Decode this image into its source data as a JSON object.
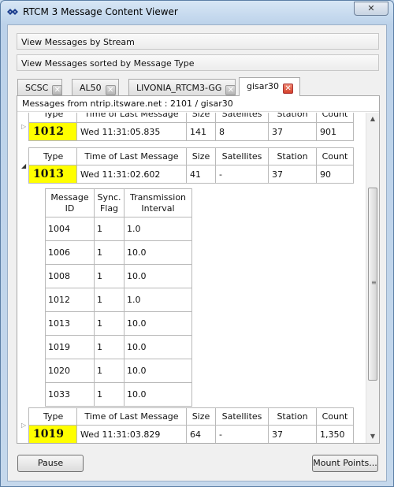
{
  "window": {
    "title": "RTCM 3 Message Content Viewer",
    "close_glyph": "✕"
  },
  "bars": {
    "by_stream": "View Messages by Stream",
    "by_type": "View Messages sorted by Message Type"
  },
  "tabs": [
    {
      "label": "SCSC",
      "close": "✕"
    },
    {
      "label": "AL50",
      "close": "✕"
    },
    {
      "label": "LIVONIA_RTCM3-GG",
      "close": "✕"
    },
    {
      "label": "gisar30",
      "close": "✕",
      "active": true
    }
  ],
  "panel": {
    "header": "Messages from ntrip.itsware.net : 2101 / gisar30"
  },
  "columns": {
    "type": "Type",
    "time": "Time of Last Message",
    "size": "Size",
    "satellites": "Satellites",
    "station": "Station",
    "count": "Count"
  },
  "messages": [
    {
      "type": "1012",
      "time": "Wed 11:31:05.835",
      "size": "141",
      "satellites": "8",
      "station": "37",
      "count": "901",
      "expanded": false
    },
    {
      "type": "1013",
      "time": "Wed 11:31:02.602",
      "size": "41",
      "satellites": "-",
      "station": "37",
      "count": "90",
      "expanded": true
    },
    {
      "type": "1019",
      "time": "Wed 11:31:03.829",
      "size": "64",
      "satellites": "-",
      "station": "37",
      "count": "1,350",
      "expanded": false
    }
  ],
  "detail": {
    "headers": {
      "id": "Message ID",
      "sync": "Sync. Flag",
      "interval": "Transmission Interval"
    },
    "rows": [
      {
        "id": "1004",
        "sync": "1",
        "interval": "1.0"
      },
      {
        "id": "1006",
        "sync": "1",
        "interval": "10.0"
      },
      {
        "id": "1008",
        "sync": "1",
        "interval": "10.0"
      },
      {
        "id": "1012",
        "sync": "1",
        "interval": "1.0"
      },
      {
        "id": "1013",
        "sync": "1",
        "interval": "10.0"
      },
      {
        "id": "1019",
        "sync": "1",
        "interval": "10.0"
      },
      {
        "id": "1020",
        "sync": "1",
        "interval": "10.0"
      },
      {
        "id": "1033",
        "sync": "1",
        "interval": "10.0"
      }
    ]
  },
  "buttons": {
    "pause": "Pause",
    "mount_points": "Mount Points..."
  },
  "icons": {
    "app": "app-diamond-icon",
    "expand": "triangle-right-icon",
    "collapse": "triangle-down-icon"
  }
}
